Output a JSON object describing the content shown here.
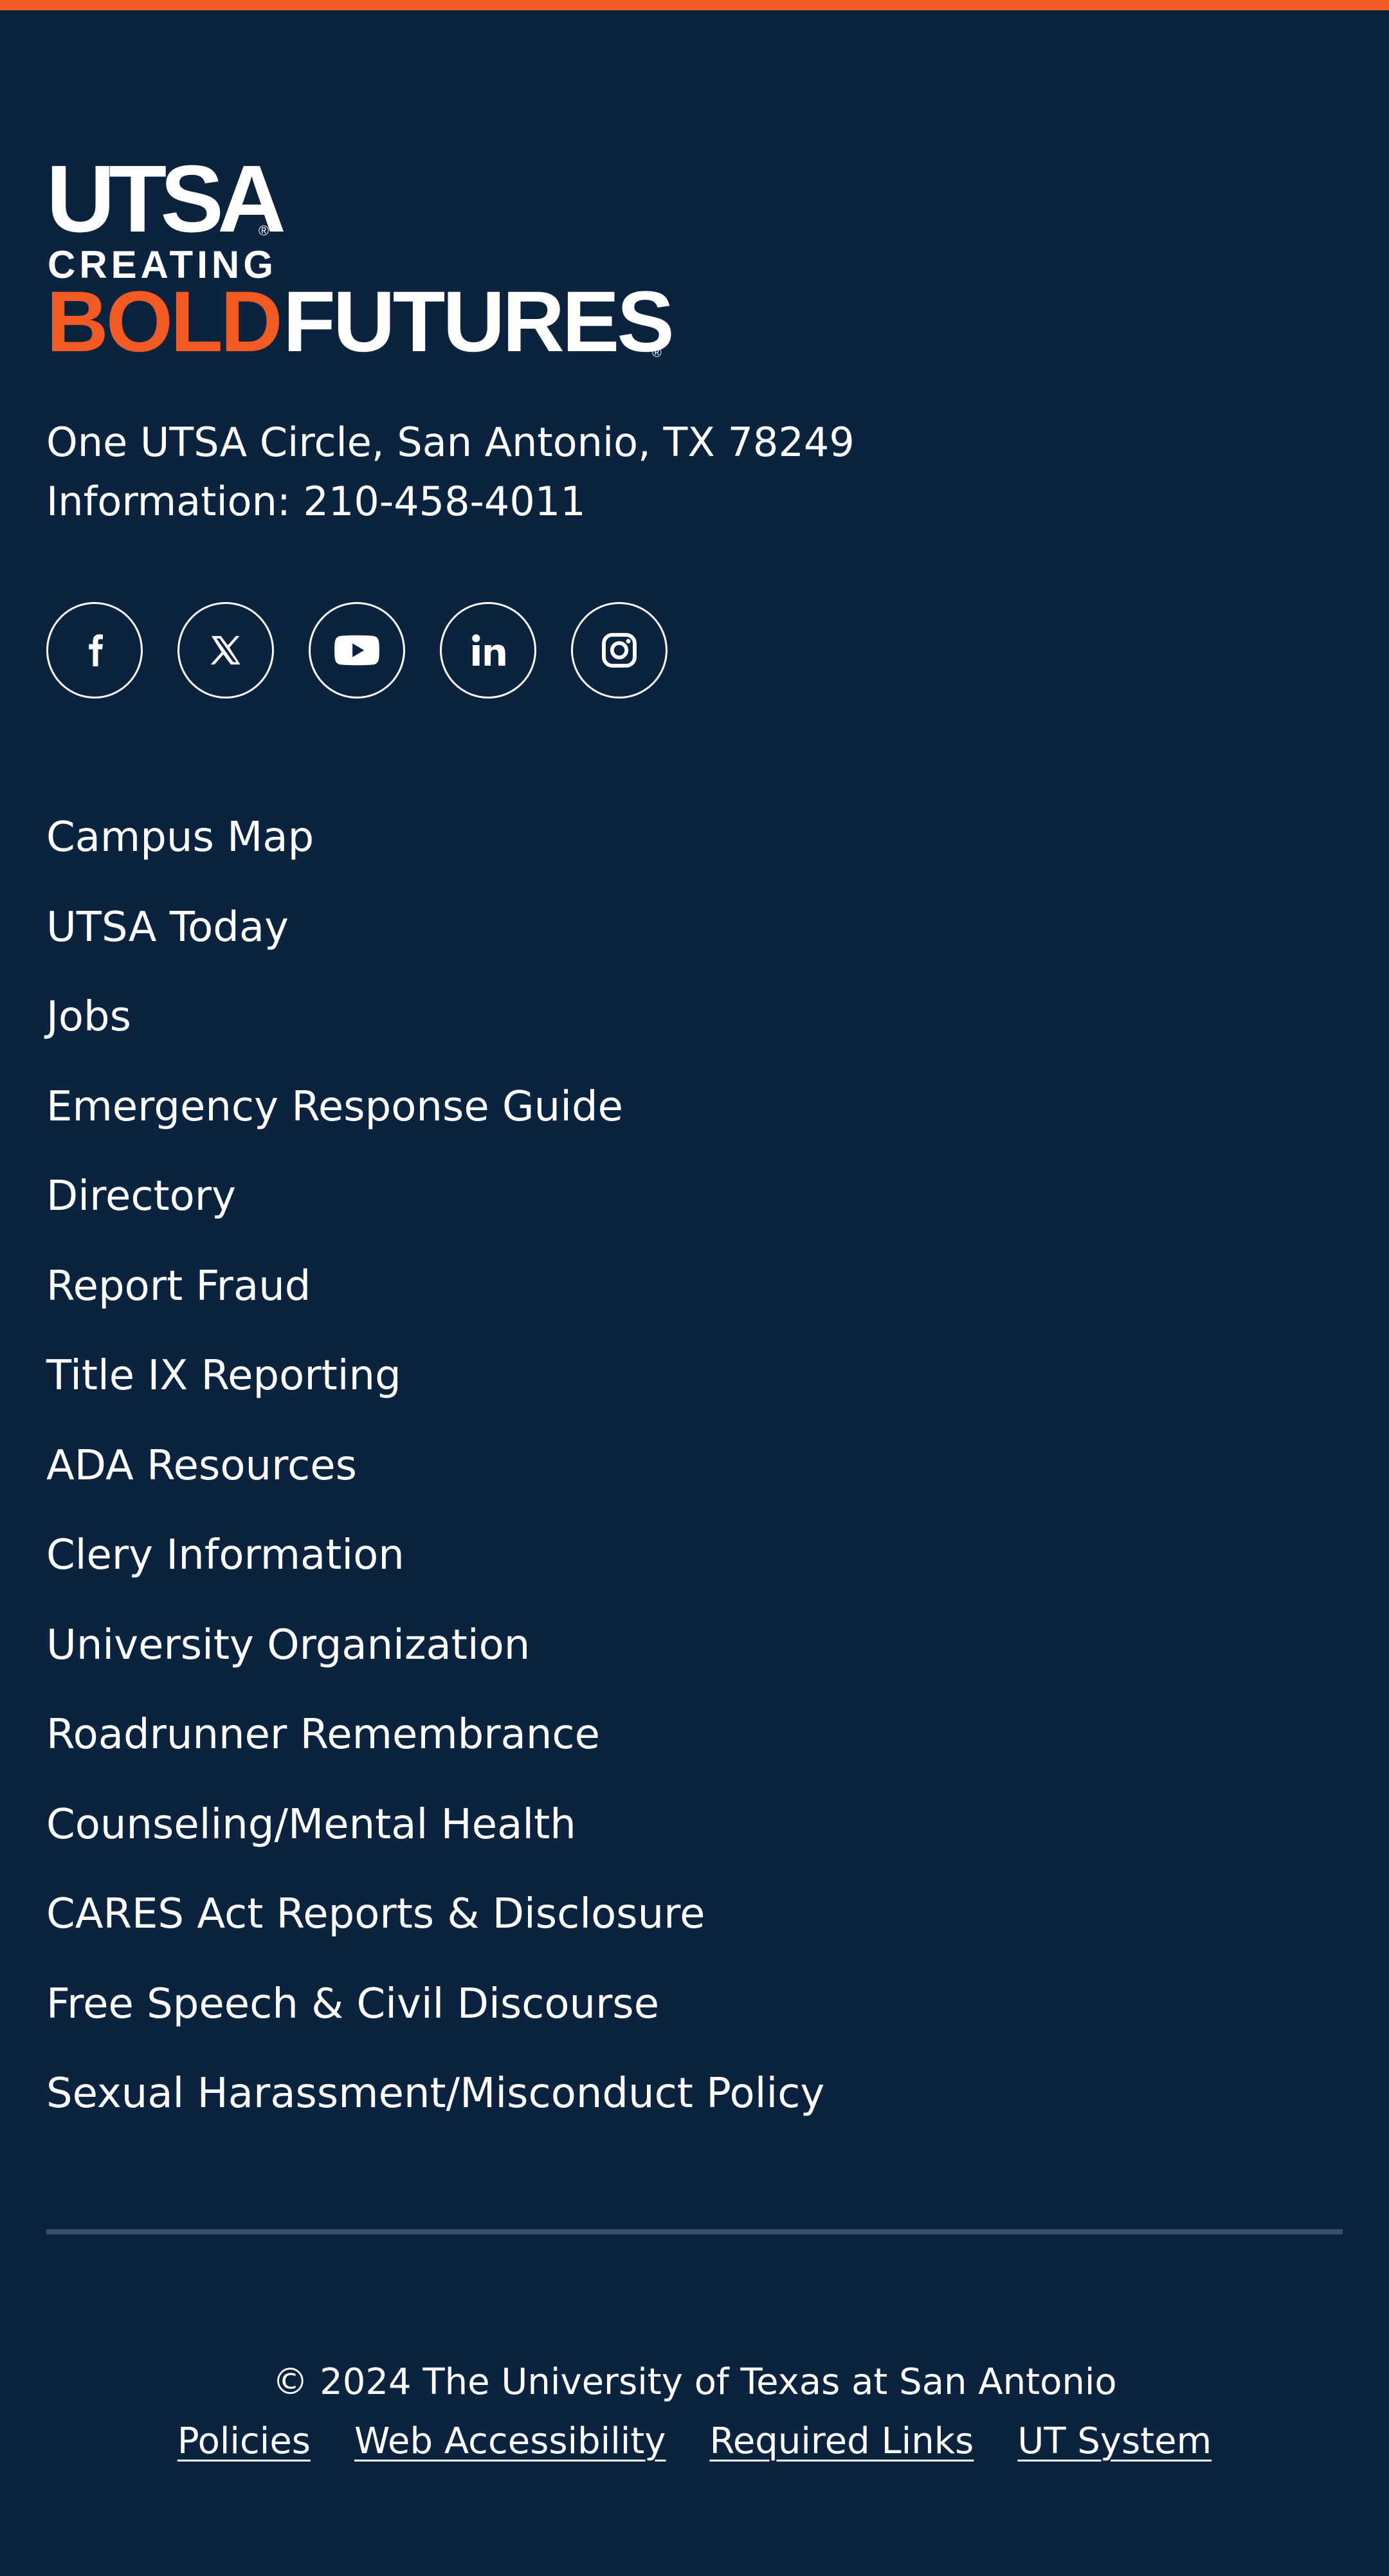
{
  "colors": {
    "background": "#0c2340",
    "accent": "#f15a22",
    "text": "#ffffff",
    "divider": "#3a4d66"
  },
  "logo": {
    "utsa": "UTSA",
    "creating": "CREATING",
    "bold": "BOLD",
    "futures": "FUTURES",
    "registered": "®"
  },
  "contact": {
    "address": "One UTSA Circle, San Antonio, TX 78249",
    "phone": "Information: 210-458-4011"
  },
  "social": [
    {
      "icon": "facebook-icon"
    },
    {
      "icon": "x-icon"
    },
    {
      "icon": "youtube-icon"
    },
    {
      "icon": "linkedin-icon"
    },
    {
      "icon": "instagram-icon"
    }
  ],
  "links": [
    "Campus Map",
    "UTSA Today",
    "Jobs",
    "Emergency Response Guide",
    "Directory",
    "Report Fraud",
    "Title IX Reporting",
    "ADA Resources",
    "Clery Information",
    "University Organization",
    "Roadrunner Remembrance",
    "Counseling/Mental Health",
    "CARES Act Reports & Disclosure",
    "Free Speech & Civil Discourse",
    "Sexual Harassment/Misconduct Policy"
  ],
  "bottom": {
    "copyright": "© 2024 The University of Texas at San Antonio",
    "links": [
      "Policies",
      "Web Accessibility",
      "Required Links",
      "UT System"
    ]
  }
}
